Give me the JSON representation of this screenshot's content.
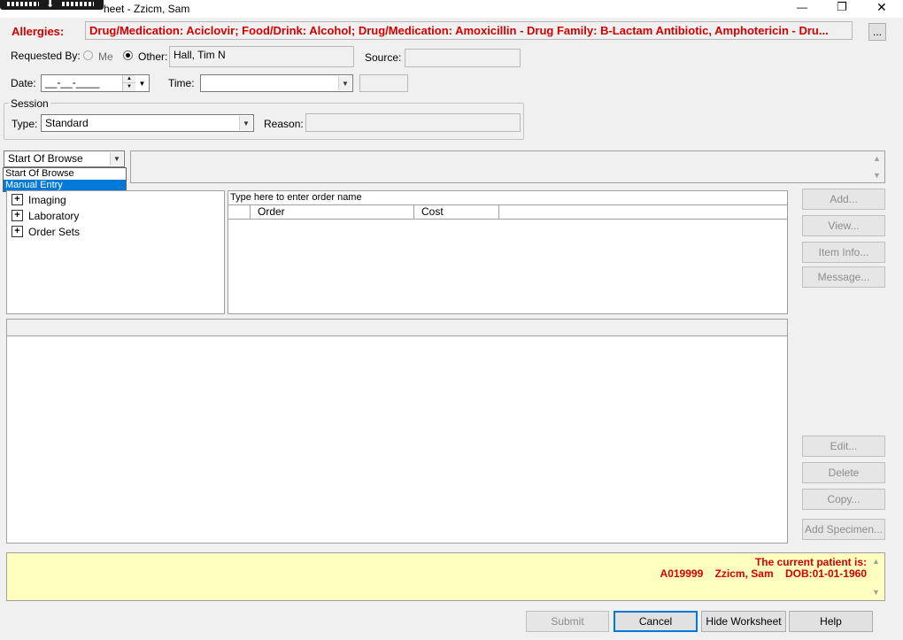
{
  "window": {
    "title": "heet - Zzicm, Sam",
    "controls": {
      "minimize": "—",
      "restore": "❐",
      "close": "✕"
    }
  },
  "allergies": {
    "label": "Allergies:",
    "value": "Drug/Medication: Aciclovir; Food/Drink: Alcohol; Drug/Medication: Amoxicillin - Drug Family: B-Lactam Antibiotic, Amphotericin - Dru...",
    "more_button": "..."
  },
  "requested_by": {
    "label": "Requested By:",
    "me_label": "Me",
    "other_label": "Other:",
    "other_value": "Hall, Tim N",
    "source_label": "Source:",
    "source_value": ""
  },
  "date": {
    "label": "Date:",
    "value": "__-__-____"
  },
  "time": {
    "label": "Time:",
    "value": ""
  },
  "session": {
    "group_label": "Session",
    "type_label": "Type:",
    "type_value": "Standard",
    "reason_label": "Reason:",
    "reason_value": ""
  },
  "browse": {
    "selected": "Start Of Browse",
    "options": [
      "Start Of Browse",
      "Manual Entry"
    ]
  },
  "tree": {
    "items": [
      "Imaging",
      "Laboratory",
      "Order Sets"
    ]
  },
  "order_grid": {
    "search_placeholder": "Type here to enter order name",
    "columns": [
      "Order",
      "Cost"
    ]
  },
  "side_buttons_top": [
    "Add...",
    "View...",
    "Item Info...",
    "Message..."
  ],
  "side_buttons_bottom": [
    "Edit...",
    "Delete",
    "Copy...",
    "Add Specimen..."
  ],
  "patient_banner": {
    "line1": "The current patient is:",
    "line2": "A019999    Zzicm, Sam    DOB:01-01-1960"
  },
  "footer_buttons": {
    "submit": "Submit",
    "cancel": "Cancel",
    "hide_worksheet": "Hide Worksheet",
    "help": "Help"
  },
  "colors": {
    "allergy_red": "#d40000",
    "selection_blue": "#0078d7",
    "banner_yellow": "#ffffc0"
  }
}
